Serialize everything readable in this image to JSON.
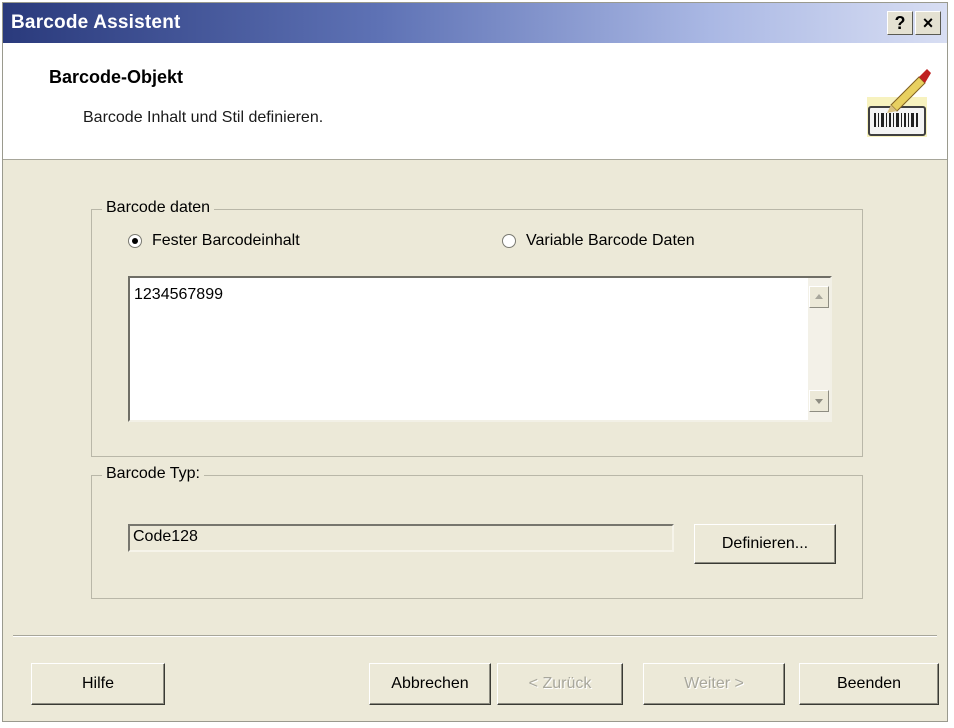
{
  "window": {
    "title": "Barcode Assistent",
    "help_button": "?",
    "close_button": "×"
  },
  "header": {
    "title": "Barcode-Objekt",
    "subtitle": "Barcode Inhalt und Stil definieren.",
    "icon": "barcode-wizard-icon"
  },
  "barcode_data": {
    "legend": "Barcode daten",
    "radio_fixed": {
      "label": "Fester Barcodeinhalt",
      "checked": true
    },
    "radio_variable": {
      "label": "Variable Barcode Daten",
      "checked": false
    },
    "content": "1234567899"
  },
  "barcode_type": {
    "legend": "Barcode Typ:",
    "value": "Code128",
    "define_button": "Definieren..."
  },
  "footer": {
    "help": "Hilfe",
    "cancel": "Abbrechen",
    "back": "< Zurück",
    "next": "Weiter >",
    "finish": "Beenden"
  },
  "colors": {
    "titlebar_start": "#2a3a7c",
    "titlebar_end": "#d8def3",
    "dialog_bg": "#ece9d8",
    "disabled_text": "#a8a79c"
  }
}
